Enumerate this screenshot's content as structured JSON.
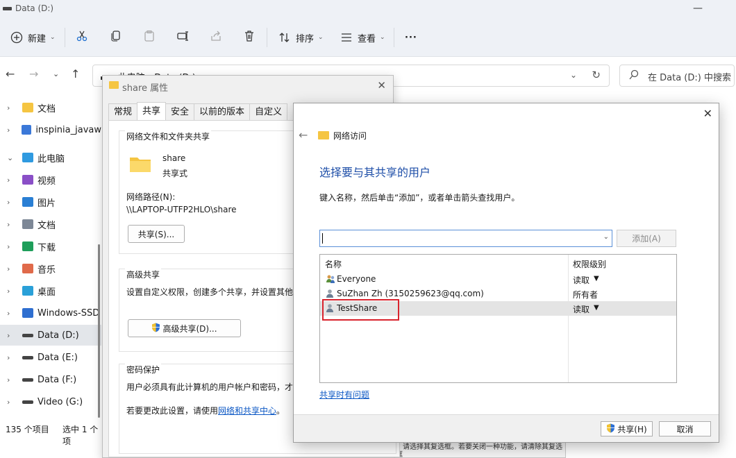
{
  "explorer": {
    "title": "Data (D:)",
    "toolbar": {
      "new_label": "新建",
      "sort_label": "排序",
      "view_label": "查看",
      "more_label": "···"
    },
    "address": {
      "crumbs": "▬  ›  此电脑  ›  Data (D:)",
      "search_placeholder": "在 Data (D:) 中搜索"
    },
    "nav": [
      {
        "label": "文档",
        "icon": "folder-icon",
        "color": "#f5c542"
      },
      {
        "label": "inspinia_javaw",
        "icon": "zip-icon",
        "color": "#3b78d8"
      },
      {
        "label": "此电脑",
        "icon": "computer-icon",
        "color": "#2f9ae0"
      },
      {
        "label": "视频",
        "icon": "video-icon",
        "color": "#8a4fc7"
      },
      {
        "label": "图片",
        "icon": "pictures-icon",
        "color": "#2a7fd4"
      },
      {
        "label": "文档",
        "icon": "documents-icon",
        "color": "#7d8796"
      },
      {
        "label": "下载",
        "icon": "download-icon",
        "color": "#1e9e5a"
      },
      {
        "label": "音乐",
        "icon": "music-icon",
        "color": "#e06a4a"
      },
      {
        "label": "桌面",
        "icon": "desktop-icon",
        "color": "#2aa0d8"
      },
      {
        "label": "Windows-SSD",
        "icon": "windows-drive-icon",
        "color": "#2f6fd0"
      },
      {
        "label": "Data (D:)",
        "icon": "drive-icon",
        "color": "#444444"
      },
      {
        "label": "Data (E:)",
        "icon": "drive-icon",
        "color": "#444444"
      },
      {
        "label": "Data (F:)",
        "icon": "drive-icon",
        "color": "#444444"
      },
      {
        "label": "Video (G:)",
        "icon": "drive-icon",
        "color": "#444444"
      }
    ],
    "status": {
      "items": "135 个项目",
      "selected": "选中 1 个项"
    },
    "desc_peek": "，请选择其复选框。若要关闭一种功能，请清除其复选框"
  },
  "properties": {
    "title": "share 属性",
    "tabs": [
      "常规",
      "共享",
      "安全",
      "以前的版本",
      "自定义"
    ],
    "active_tab": "共享",
    "network_group": {
      "title": "网络文件和文件夹共享",
      "folder_name": "share",
      "share_state": "共享式",
      "path_label": "网络路径(N):",
      "path_value": "\\\\LAPTOP-UTFP2HLO\\share",
      "share_button": "共享(S)..."
    },
    "advanced_group": {
      "title": "高级共享",
      "desc": "设置自定义权限，创建多个共享，并设置其他",
      "button": "高级共享(D)..."
    },
    "password_group": {
      "title": "密码保护",
      "desc": "用户必须具有此计算机的用户帐户和密码，才",
      "change_prefix": "若要更改此设置，请使用",
      "change_link": "网络和共享中心",
      "change_suffix": "。"
    }
  },
  "network_access": {
    "header": "网络访问",
    "heading": "选择要与其共享的用户",
    "instruction": "键入名称，然后单击“添加”，或者单击箭头查找用户。",
    "input_value": "",
    "add_button": "添加(A)",
    "columns": {
      "name": "名称",
      "permission": "权限级别"
    },
    "users": [
      {
        "name": "Everyone",
        "permission": "读取",
        "has_dropdown": true
      },
      {
        "name": "SuZhan Zh (3150259623@qq.com)",
        "permission": "所有者",
        "has_dropdown": false
      },
      {
        "name": "TestShare",
        "permission": "读取",
        "has_dropdown": true
      }
    ],
    "selected_user": "TestShare",
    "help_link": "共享时有问题",
    "share_button": "共享(H)",
    "cancel_button": "取消",
    "accent_color": "#1f4fa8",
    "highlight_color": "#d9232d"
  }
}
